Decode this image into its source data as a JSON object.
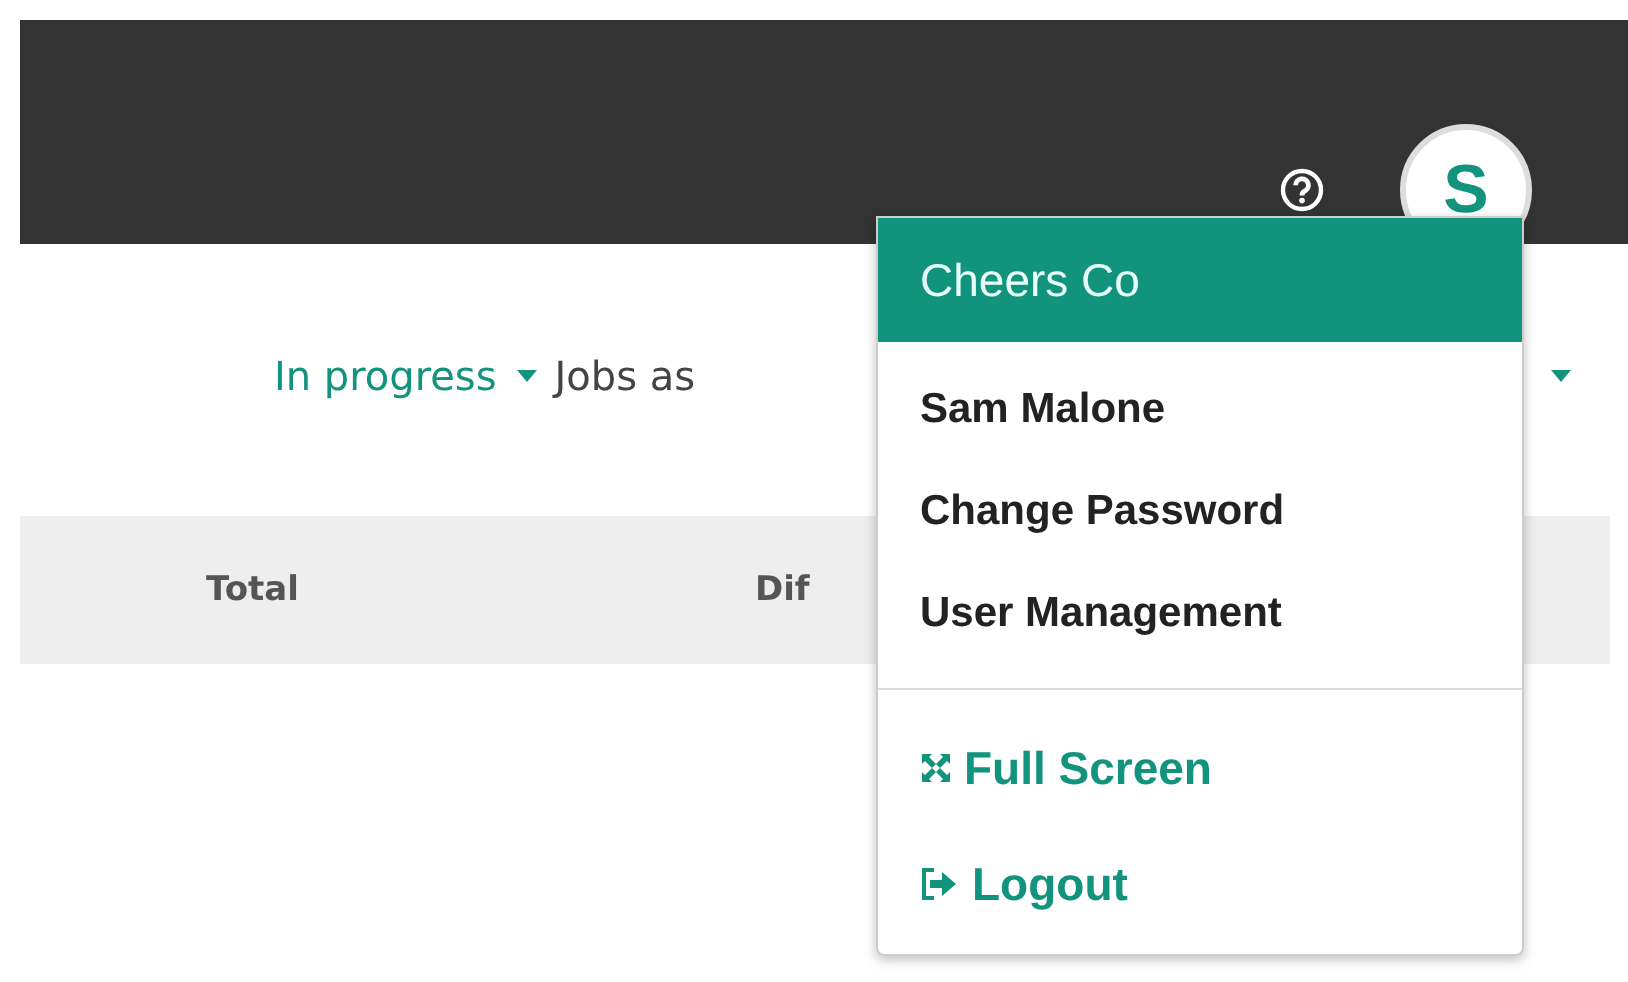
{
  "header": {
    "avatar_letter": "S"
  },
  "filters": [
    {
      "label": "In progress",
      "kind": "dropdown"
    },
    {
      "label": "Jobs as",
      "kind": "text"
    },
    {
      "kind": "caret"
    }
  ],
  "table": {
    "columns": [
      "Total",
      "Dif"
    ]
  },
  "user_menu": {
    "title": "Cheers Co",
    "items": [
      {
        "label": "Sam Malone",
        "kind": "user"
      },
      {
        "label": "Change Password",
        "kind": "link"
      },
      {
        "label": "User Management",
        "kind": "link"
      },
      {
        "label": "Full Screen",
        "kind": "fullscreen"
      },
      {
        "label": "Logout",
        "kind": "logout"
      }
    ]
  }
}
